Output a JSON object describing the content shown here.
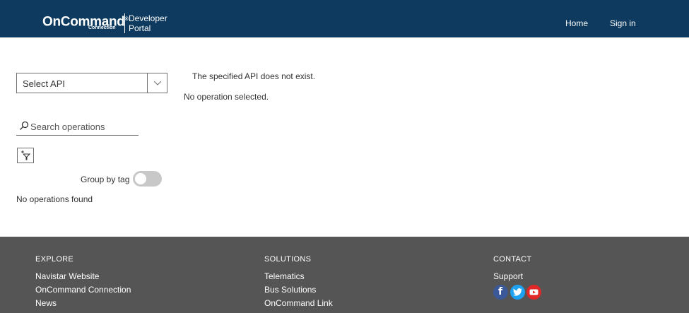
{
  "header": {
    "logo_main": "OnCommand",
    "logo_mark": "®",
    "logo_sub": "Connection",
    "portal_line1": "Developer",
    "portal_line2": "Portal",
    "nav": {
      "home": "Home",
      "sign_in": "Sign in"
    },
    "bg_color": "#0d3a5e"
  },
  "sidebar": {
    "select_api": {
      "label": "Select API",
      "icon": "chevron-down-icon"
    },
    "search": {
      "placeholder": "Search operations",
      "value": "",
      "icon": "search-icon"
    },
    "filter_icon": "filter-icon",
    "group_by_tag": {
      "label": "Group by tag",
      "enabled": false
    },
    "no_operations": "No operations found"
  },
  "main": {
    "api_message": "The specified API does not exist.",
    "operation_message": "No operation selected."
  },
  "footer": {
    "bg_color": "#555555",
    "columns": [
      {
        "heading": "EXPLORE",
        "links": [
          "Navistar Website",
          "OnCommand Connection",
          "News"
        ]
      },
      {
        "heading": "SOLUTIONS",
        "links": [
          "Telematics",
          "Bus Solutions",
          "OnCommand Link"
        ]
      },
      {
        "heading": "CONTACT",
        "links": [
          "Support"
        ]
      }
    ],
    "social": [
      {
        "name": "facebook-icon",
        "color": "#3b5998"
      },
      {
        "name": "twitter-icon",
        "color": "#1da1f2"
      },
      {
        "name": "youtube-icon",
        "color": "#e02828"
      }
    ]
  }
}
